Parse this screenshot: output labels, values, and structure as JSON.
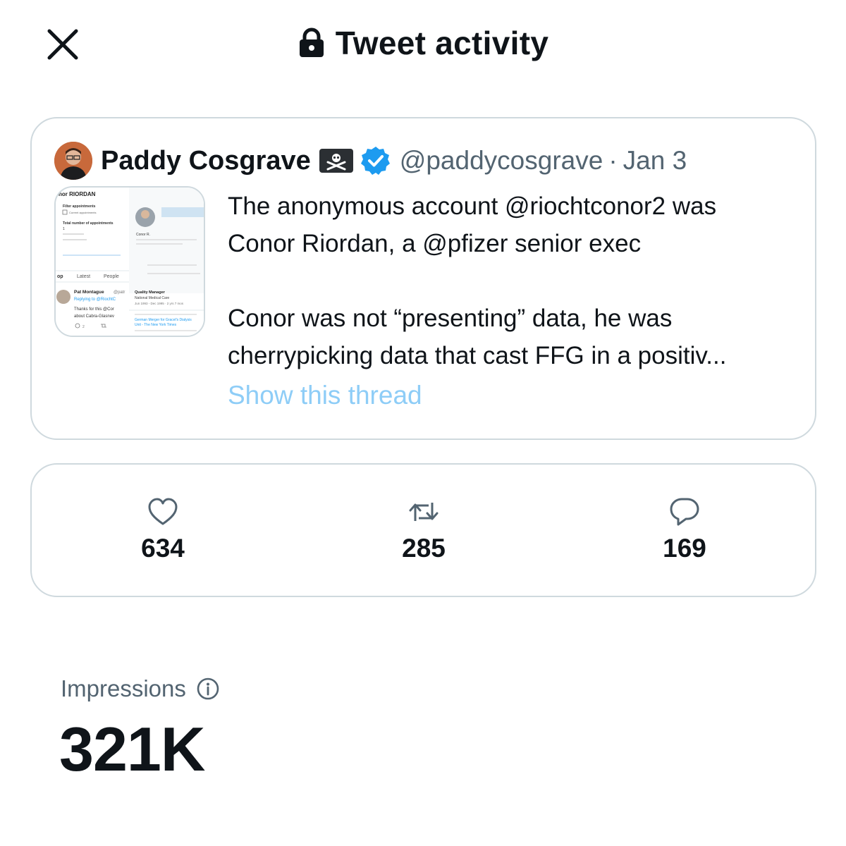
{
  "header": {
    "title": "Tweet activity",
    "close_icon": "close-icon",
    "lock_icon": "lock-icon"
  },
  "tweet": {
    "author_name": "Paddy Cosgrave",
    "author_badge_icon": "skull-crossbones-flag-icon",
    "verified_icon": "verified-badge-icon",
    "handle": "@paddycosgrave",
    "separator": "·",
    "date": "Jan 3",
    "text_lines": [
      "The anonymous account @riochtconor2 was",
      "Conor Riordan, a @pfizer senior exec",
      "",
      "Conor was not “presenting” data, he was",
      "cherrypicking data that cast FFG in a positiv..."
    ],
    "show_thread": "Show this thread",
    "media": {
      "heading": "nor RIORDAN",
      "filter_label": "Filter appointments",
      "current_label": "Current appointments",
      "total_label": "Total number of appointments",
      "total_value": "1",
      "tabs": [
        "op",
        "Latest",
        "People"
      ],
      "reply_name": "Pat Montague",
      "reply_handle": "@patr",
      "reply_to": "Replying to @RiochtC",
      "reply_line1": "Thanks for this @Cor",
      "reply_line2": "about Cabra-Glasnev",
      "reply_count": "2",
      "right_title": "Conor R.",
      "right_role": "Quality Manager",
      "right_org": "National Medical Care",
      "right_dates": "Jun 1993 - Dec 1995 · 2 yrs 7 mos",
      "right_link1": "German Merger for Gracel's Dialysis",
      "right_link2": "Unit - The New York Times"
    }
  },
  "stats": {
    "likes": {
      "icon": "heart-icon",
      "count": "634"
    },
    "retweets": {
      "icon": "retweet-icon",
      "count": "285"
    },
    "replies": {
      "icon": "reply-icon",
      "count": "169"
    }
  },
  "impressions": {
    "label": "Impressions",
    "info_icon": "info-icon",
    "value": "321K"
  },
  "colors": {
    "text": "#0f1419",
    "secondary": "#536471",
    "border": "#cfd9de",
    "link_faded": "#8ecdf7",
    "verified": "#1d9bf0"
  }
}
